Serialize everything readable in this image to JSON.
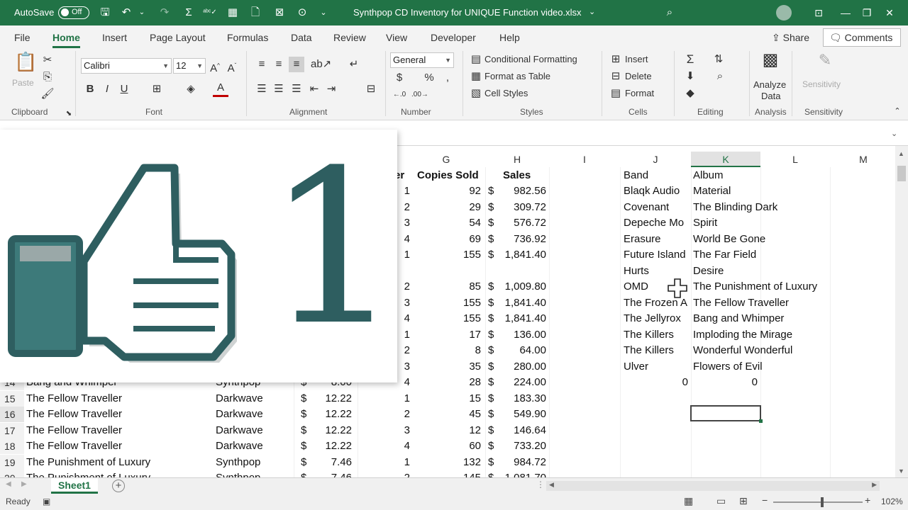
{
  "titlebar": {
    "autosave_label": "AutoSave",
    "autosave_state": "Off",
    "document_title": "Synthpop CD Inventory for UNIQUE Function video.xlsx",
    "title_caret": "⌄"
  },
  "tabs": [
    "File",
    "Home",
    "Insert",
    "Page Layout",
    "Formulas",
    "Data",
    "Review",
    "View",
    "Developer",
    "Help"
  ],
  "active_tab": "Home",
  "share_label": "Share",
  "comments_label": "Comments",
  "ribbon": {
    "clipboard": {
      "paste": "Paste",
      "group": "Clipboard"
    },
    "font": {
      "name": "Calibri",
      "size": "12",
      "group": "Font"
    },
    "alignment": {
      "group": "Alignment"
    },
    "number": {
      "format": "General",
      "group": "Number"
    },
    "styles": {
      "conditional": "Conditional Formatting",
      "table": "Format as Table",
      "cell_styles": "Cell Styles",
      "group": "Styles"
    },
    "cells": {
      "insert": "Insert",
      "delete": "Delete",
      "format": "Format",
      "group": "Cells"
    },
    "editing": {
      "group": "Editing"
    },
    "analysis": {
      "analyze1": "Analyze",
      "analyze2": "Data",
      "group": "Analysis"
    },
    "sensitivity": {
      "label": "Sensitivity",
      "group": "Sensitivity"
    }
  },
  "grid": {
    "columns": [
      "G",
      "H",
      "I",
      "J",
      "K",
      "L",
      "M"
    ],
    "selected_column": "K",
    "headers": {
      "col_f": "er",
      "copies_sold": "Copies Sold",
      "sales": "Sales",
      "band": "Band",
      "album": "Album"
    },
    "top_rows": [
      {
        "f": "1",
        "g": "92",
        "cur": "$",
        "h": "982.56",
        "band": "Blaqk Audio",
        "album": "Material"
      },
      {
        "f": "2",
        "g": "29",
        "cur": "$",
        "h": "309.72",
        "band": "Covenant",
        "album": "The Blinding Dark"
      },
      {
        "f": "3",
        "g": "54",
        "cur": "$",
        "h": "576.72",
        "band": "Depeche Mo",
        "album": "Spirit"
      },
      {
        "f": "4",
        "g": "69",
        "cur": "$",
        "h": "736.92",
        "band": "Erasure",
        "album": "World Be Gone"
      },
      {
        "f": "1",
        "g": "155",
        "cur": "$",
        "h": "1,841.40",
        "band": "Future Island",
        "album": "The Far Field"
      },
      {
        "f": "",
        "g": "",
        "cur": "",
        "h": "",
        "band": "Hurts",
        "album": "Desire"
      },
      {
        "f": "2",
        "g": "85",
        "cur": "$",
        "h": "1,009.80",
        "band": "OMD",
        "album": "The Punishment of Luxury"
      },
      {
        "f": "3",
        "g": "155",
        "cur": "$",
        "h": "1,841.40",
        "band": "The Frozen A",
        "album": "The Fellow Traveller"
      },
      {
        "f": "4",
        "g": "155",
        "cur": "$",
        "h": "1,841.40",
        "band": "The Jellyrox",
        "album": "Bang and Whimper"
      },
      {
        "f": "1",
        "g": "17",
        "cur": "$",
        "h": "136.00",
        "band": "The Killers",
        "album": "Imploding the Mirage"
      },
      {
        "f": "2",
        "g": "8",
        "cur": "$",
        "h": "64.00",
        "band": "The Killers",
        "album": "Wonderful Wonderful"
      },
      {
        "f": "3",
        "g": "35",
        "cur": "$",
        "h": "280.00",
        "band": "Ulver",
        "album": "Flowers of Evil"
      },
      {
        "f": "4",
        "g": "28",
        "cur": "$",
        "h": "224.00",
        "band": "0",
        "album": "0"
      }
    ],
    "bottom_rows": [
      {
        "row": "14",
        "album": "Bang and Whimper",
        "genre": "Synthpop",
        "cur": "$",
        "price": "8.00"
      },
      {
        "row": "15",
        "album": "The Fellow Traveller",
        "genre": "Darkwave",
        "cur": "$",
        "price": "12.22",
        "f": "1",
        "g": "15",
        "cur2": "$",
        "h": "183.30"
      },
      {
        "row": "16",
        "album": "The Fellow Traveller",
        "genre": "Darkwave",
        "cur": "$",
        "price": "12.22",
        "f": "2",
        "g": "45",
        "cur2": "$",
        "h": "549.90"
      },
      {
        "row": "17",
        "album": "The Fellow Traveller",
        "genre": "Darkwave",
        "cur": "$",
        "price": "12.22",
        "f": "3",
        "g": "12",
        "cur2": "$",
        "h": "146.64"
      },
      {
        "row": "18",
        "album": "The Fellow Traveller",
        "genre": "Darkwave",
        "cur": "$",
        "price": "12.22",
        "f": "4",
        "g": "60",
        "cur2": "$",
        "h": "733.20"
      },
      {
        "row": "19",
        "album": "The Punishment of Luxury",
        "genre": "Synthpop",
        "cur": "$",
        "price": "7.46",
        "f": "1",
        "g": "132",
        "cur2": "$",
        "h": "984.72"
      },
      {
        "row": "20",
        "album": "The Punishment of Luxury",
        "genre": "Synthpop",
        "cur": "$",
        "price": "7.46",
        "f": "2",
        "g": "145",
        "cur2": "$",
        "h": "1,081.70"
      }
    ]
  },
  "sheet_tab": "Sheet1",
  "status": {
    "ready": "Ready",
    "zoom": "102%"
  },
  "overlay": {
    "number": "1",
    "icon": "thumbs-up"
  },
  "colors": {
    "excel_green": "#217346",
    "thumb_dark": "#2e5e60",
    "thumb_fill": "#3d7a7a",
    "thumb_light": "#9aa8a8"
  }
}
